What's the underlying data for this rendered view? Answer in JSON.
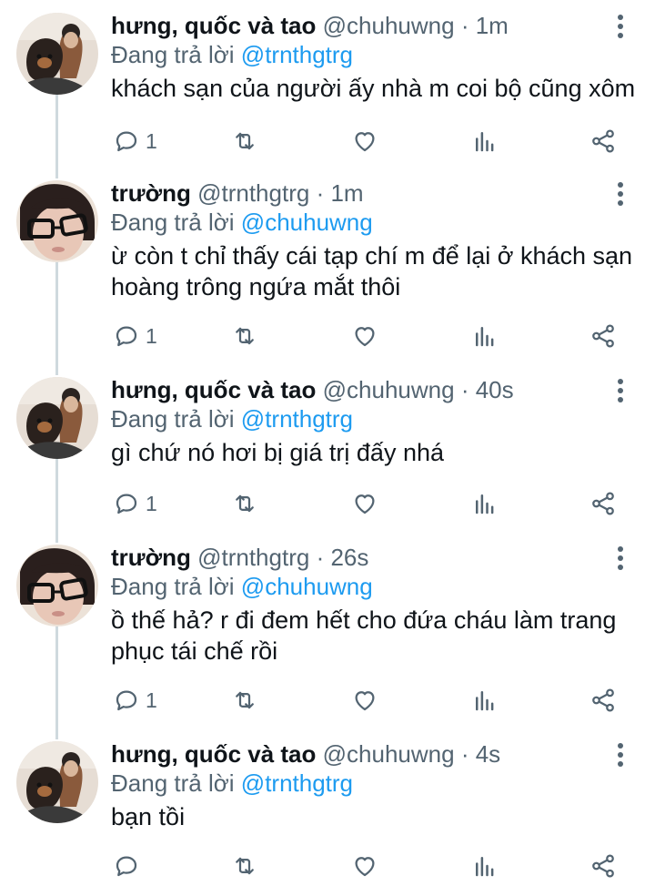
{
  "tweets": [
    {
      "name": "hưng, quốc và tao",
      "handle": "@chuhuwng",
      "dot": "·",
      "time": "1m",
      "reply_prefix": "Đang trả lời",
      "reply_to": "@trnthgtrg",
      "text": "khách sạn của người ấy nhà m coi bộ cũng xôm",
      "reply_count": "1",
      "avatar": "dog-avatar"
    },
    {
      "name": "trường",
      "handle": "@trnthgtrg",
      "dot": "·",
      "time": "1m",
      "reply_prefix": "Đang trả lời",
      "reply_to": "@chuhuwng",
      "text": "ừ còn t chỉ thấy cái tạp chí m để lại ở khách sạn hoàng trông ngứa mắt thôi",
      "reply_count": "1",
      "avatar": "glasses-avatar"
    },
    {
      "name": "hưng, quốc và tao",
      "handle": "@chuhuwng",
      "dot": "·",
      "time": "40s",
      "reply_prefix": "Đang trả lời",
      "reply_to": "@trnthgtrg",
      "text": "gì chứ nó hơi bị giá trị đấy nhá",
      "reply_count": "1",
      "avatar": "dog-avatar"
    },
    {
      "name": "trường",
      "handle": "@trnthgtrg",
      "dot": "·",
      "time": "26s",
      "reply_prefix": "Đang trả lời",
      "reply_to": "@chuhuwng",
      "text": "ồ thế hả? r đi đem hết cho đứa cháu làm trang phục tái chế rồi",
      "reply_count": "1",
      "avatar": "glasses-avatar"
    },
    {
      "name": "hưng, quốc và tao",
      "handle": "@chuhuwng",
      "dot": "·",
      "time": "4s",
      "reply_prefix": "Đang trả lời",
      "reply_to": "@trnthgtrg",
      "text": "bạn tồi",
      "reply_count": "",
      "avatar": "dog-avatar"
    }
  ],
  "colors": {
    "text": "#0f1419",
    "secondary": "#536471",
    "link": "#1d9bf0",
    "thread_line": "#cfd9de"
  },
  "icons": [
    "reply-icon",
    "retweet-icon",
    "like-icon",
    "analytics-icon",
    "share-icon",
    "more-icon"
  ]
}
